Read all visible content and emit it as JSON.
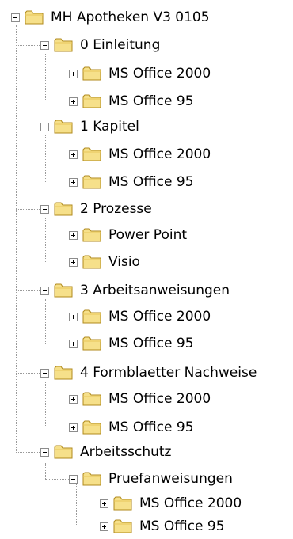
{
  "tree": {
    "root": {
      "label": "MH Apotheken V3 0105",
      "icon": "folder-icon",
      "state": "expanded"
    },
    "n0": {
      "label": "0 Einleitung",
      "state": "expanded"
    },
    "n0a": {
      "label": "MS Office 2000",
      "state": "collapsed"
    },
    "n0b": {
      "label": "MS Office 95",
      "state": "collapsed"
    },
    "n1": {
      "label": "1 Kapitel",
      "state": "expanded"
    },
    "n1a": {
      "label": "MS Office 2000",
      "state": "collapsed"
    },
    "n1b": {
      "label": "MS Office 95",
      "state": "collapsed"
    },
    "n2": {
      "label": "2 Prozesse",
      "state": "expanded"
    },
    "n2a": {
      "label": "Power Point",
      "state": "collapsed"
    },
    "n2b": {
      "label": "Visio",
      "state": "collapsed"
    },
    "n3": {
      "label": "3 Arbeitsanweisungen",
      "state": "expanded"
    },
    "n3a": {
      "label": "MS Office 2000",
      "state": "collapsed"
    },
    "n3b": {
      "label": "MS Office 95",
      "state": "collapsed"
    },
    "n4": {
      "label": "4 Formblaetter Nachweise",
      "state": "expanded"
    },
    "n4a": {
      "label": "MS Office 2000",
      "state": "collapsed"
    },
    "n4b": {
      "label": "MS Office 95",
      "state": "collapsed"
    },
    "n5": {
      "label": "Arbeitsschutz",
      "state": "expanded"
    },
    "n5a": {
      "label": "Pruefanweisungen",
      "state": "expanded"
    },
    "n5a1": {
      "label": "MS Office 2000",
      "state": "collapsed"
    },
    "n5a2": {
      "label": "MS Office 95",
      "state": "collapsed"
    }
  },
  "colors": {
    "folder_fill": "#f6e08a",
    "folder_outline": "#b08a1c",
    "connector": "#9a9a9a",
    "background": "#ffffff"
  }
}
